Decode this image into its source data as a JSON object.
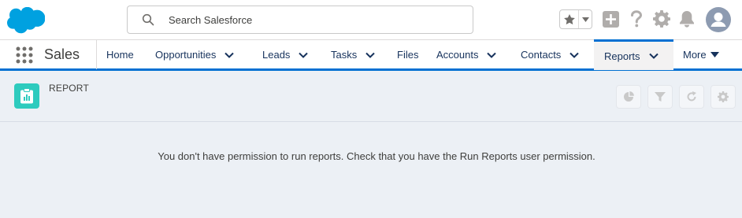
{
  "header": {
    "search_placeholder": "Search Salesforce"
  },
  "nav": {
    "app_name": "Sales",
    "tabs": [
      {
        "label": "Home",
        "has_dropdown": false
      },
      {
        "label": "Opportunities",
        "has_dropdown": true
      },
      {
        "label": "Leads",
        "has_dropdown": true
      },
      {
        "label": "Tasks",
        "has_dropdown": true
      },
      {
        "label": "Files",
        "has_dropdown": false
      },
      {
        "label": "Accounts",
        "has_dropdown": true
      },
      {
        "label": "Contacts",
        "has_dropdown": true
      },
      {
        "label": "Reports",
        "has_dropdown": true,
        "active": true
      }
    ],
    "more_label": "More"
  },
  "page": {
    "object_label": "REPORT",
    "message": "You don't have permission to run reports. Check that you have the Run Reports user permission."
  },
  "colors": {
    "brand_blue": "#00a1e0",
    "active_tab_border": "#0070d2",
    "report_icon_bg": "#2ecbbe",
    "header_icon_gray": "#b0adab"
  },
  "icons": [
    "salesforce-cloud-logo",
    "search-icon",
    "star-icon",
    "chevron-down-icon",
    "plus-icon",
    "help-icon",
    "gear-icon",
    "bell-icon",
    "avatar-icon",
    "app-launcher-icon",
    "report-icon",
    "chart-icon",
    "filter-icon",
    "refresh-icon",
    "settings-icon"
  ]
}
